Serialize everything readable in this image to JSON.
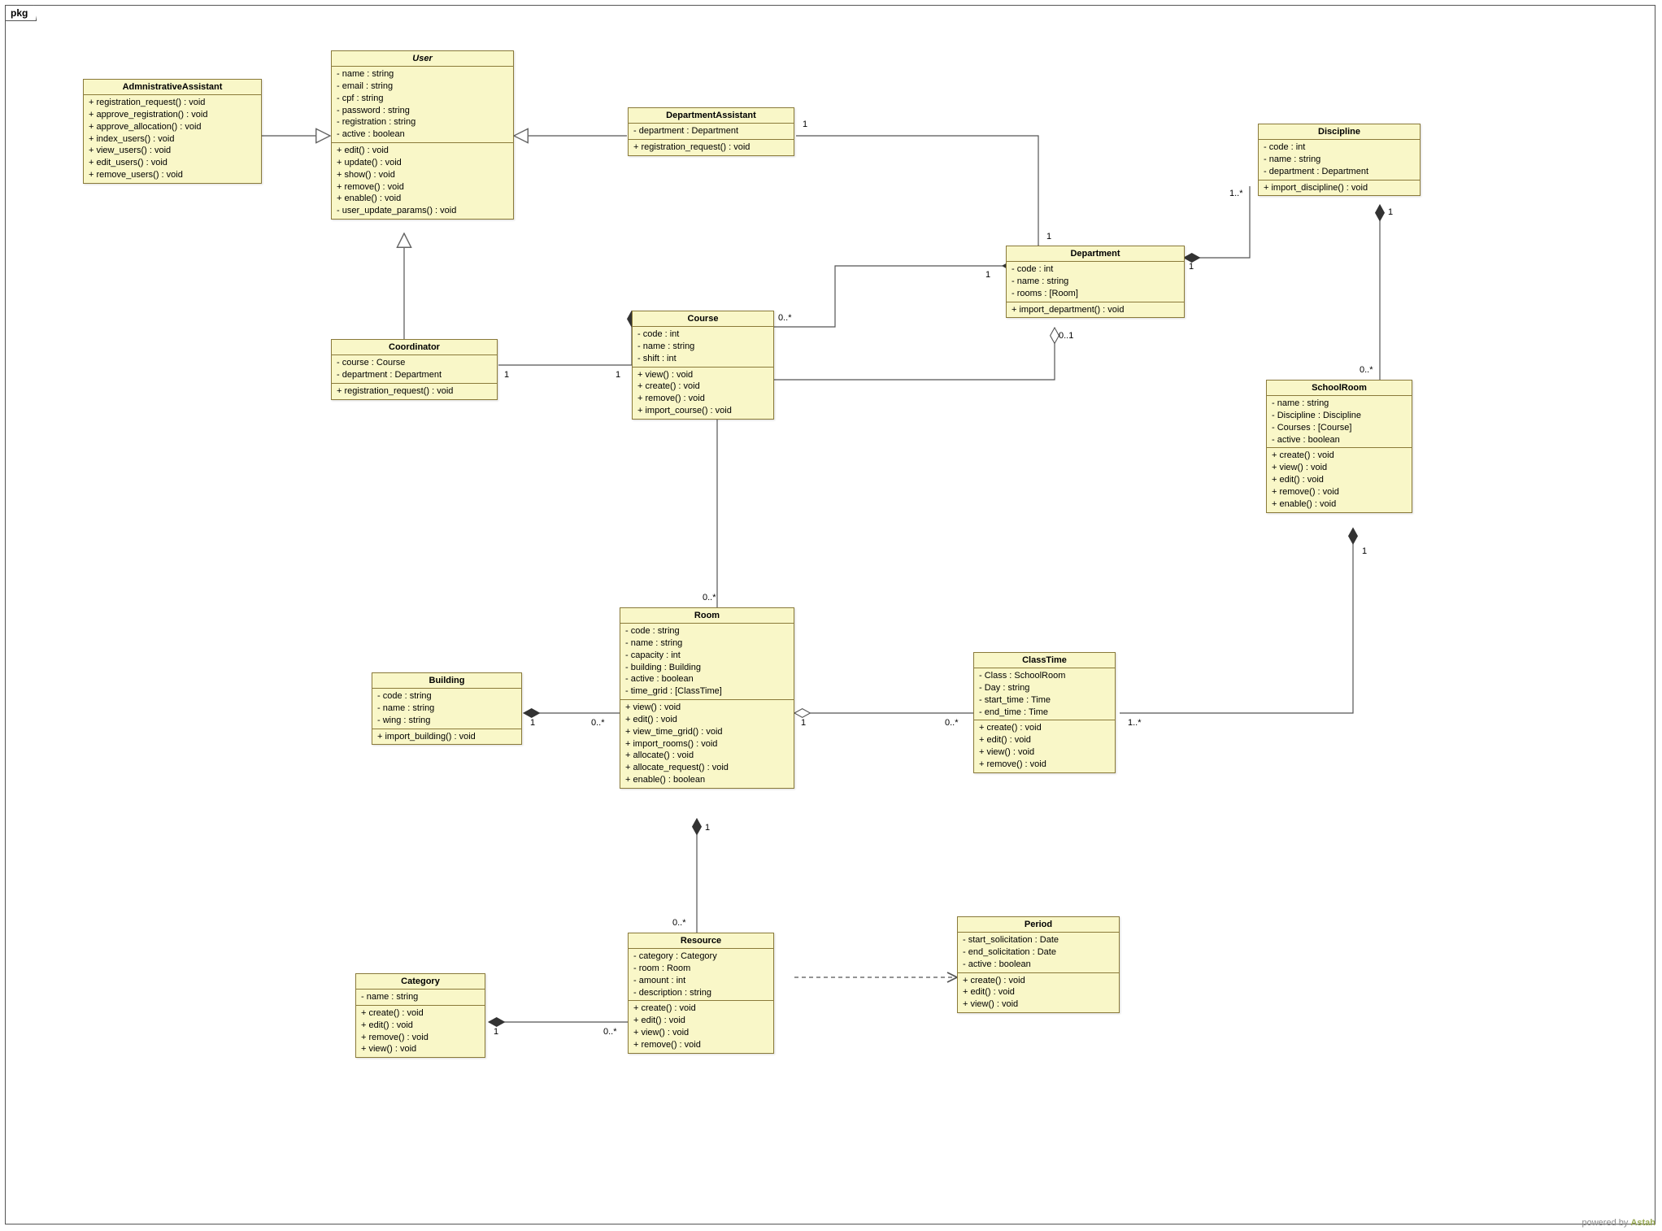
{
  "package_label": "pkg",
  "footer": {
    "pre": "powered by ",
    "brand": "Astah"
  },
  "classes": {
    "AdmnistrativeAssistant": {
      "name": "AdmnistrativeAssistant",
      "attrs": [],
      "ops": [
        "+ registration_request() : void",
        "+ approve_registration() : void",
        "+ approve_allocation() : void",
        "+ index_users() : void",
        "+ view_users() : void",
        "+ edit_users() : void",
        "+ remove_users() : void"
      ]
    },
    "User": {
      "name": "User",
      "italic": true,
      "attrs": [
        "- name : string",
        "- email : string",
        "- cpf : string",
        "- password : string",
        "- registration : string",
        "- active : boolean"
      ],
      "ops": [
        "+ edit() : void",
        "+ update() : void",
        "+ show() : void",
        "+ remove() : void",
        "+ enable() : void",
        "- user_update_params() : void"
      ]
    },
    "DepartmentAssistant": {
      "name": "DepartmentAssistant",
      "attrs": [
        "- department : Department"
      ],
      "ops": [
        "+ registration_request() : void"
      ]
    },
    "Discipline": {
      "name": "Discipline",
      "attrs": [
        "- code : int",
        "- name : string",
        "- department : Department"
      ],
      "ops": [
        "+ import_discipline() : void"
      ]
    },
    "Coordinator": {
      "name": "Coordinator",
      "attrs": [
        "- course : Course",
        "- department : Department"
      ],
      "ops": [
        "+ registration_request() : void"
      ]
    },
    "Course": {
      "name": "Course",
      "attrs": [
        "- code : int",
        "- name : string",
        "- shift : int"
      ],
      "ops": [
        "+ view() : void",
        "+ create() : void",
        "+ remove() : void",
        "+ import_course() : void"
      ]
    },
    "Department": {
      "name": "Department",
      "attrs": [
        "- code : int",
        "- name : string",
        "- rooms : [Room]"
      ],
      "ops": [
        "+ import_department() : void"
      ]
    },
    "SchoolRoom": {
      "name": "SchoolRoom",
      "attrs": [
        "- name : string",
        "- Discipline : Discipline",
        "- Courses : [Course]",
        "- active : boolean"
      ],
      "ops": [
        "+ create() : void",
        "+ view() : void",
        "+ edit() : void",
        "+ remove() : void",
        "+ enable() : void"
      ]
    },
    "Building": {
      "name": "Building",
      "attrs": [
        "- code : string",
        "- name : string",
        "- wing : string"
      ],
      "ops": [
        "+ import_building() : void"
      ]
    },
    "Room": {
      "name": "Room",
      "attrs": [
        "- code : string",
        "- name : string",
        "- capacity : int",
        "- building : Building",
        "- active : boolean",
        "- time_grid : [ClassTime]"
      ],
      "ops": [
        "+ view() : void",
        "+ edit() : void",
        "+ view_time_grid() : void",
        "+ import_rooms() : void",
        "+ allocate() : void",
        "+ allocate_request() : void",
        "+ enable() : boolean"
      ]
    },
    "ClassTime": {
      "name": "ClassTime",
      "attrs": [
        "- Class : SchoolRoom",
        "- Day : string",
        "- start_time : Time",
        "- end_time : Time"
      ],
      "ops": [
        "+ create() : void",
        "+ edit() : void",
        "+ view() : void",
        "+ remove() : void"
      ]
    },
    "Period": {
      "name": "Period",
      "attrs": [
        "- start_solicitation : Date",
        "- end_solicitation : Date",
        "- active : boolean"
      ],
      "ops": [
        "+ create() : void",
        "+ edit() : void",
        "+ view() : void"
      ]
    },
    "Resource": {
      "name": "Resource",
      "attrs": [
        "- category : Category",
        "- room : Room",
        "- amount : int",
        "- description : string"
      ],
      "ops": [
        "+ create() : void",
        "+ edit() : void",
        "+ view() : void",
        "+ remove() : void"
      ]
    },
    "Category": {
      "name": "Category",
      "attrs": [
        "- name : string"
      ],
      "ops": [
        "+ create() : void",
        "+ edit() : void",
        "+ remove() : void",
        "+ view() : void"
      ]
    }
  },
  "multiplicities": {
    "deptAssist_dept_1": "1",
    "dept_deptAssist_1": "1",
    "dept_discipline_1": "1",
    "discipline_dept_1s": "1..*",
    "coord_course_1a": "1",
    "coord_course_1b": "1",
    "course_dept_0s": "0..*",
    "dept_course_1": "1",
    "dept_room_01": "0..1",
    "room_dept_0s": "0..*",
    "discipline_school_1": "1",
    "school_discipline_0s": "0..*",
    "building_room_1": "1",
    "room_building_0s": "0..*",
    "room_classtime_1": "1",
    "classtime_room_0s": "0..*",
    "classtime_school_1s": "1..*",
    "school_classtime_1": "1",
    "room_resource_1": "1",
    "resource_room_0s": "0..*",
    "category_resource_1": "1",
    "resource_category_0s": "0..*"
  }
}
